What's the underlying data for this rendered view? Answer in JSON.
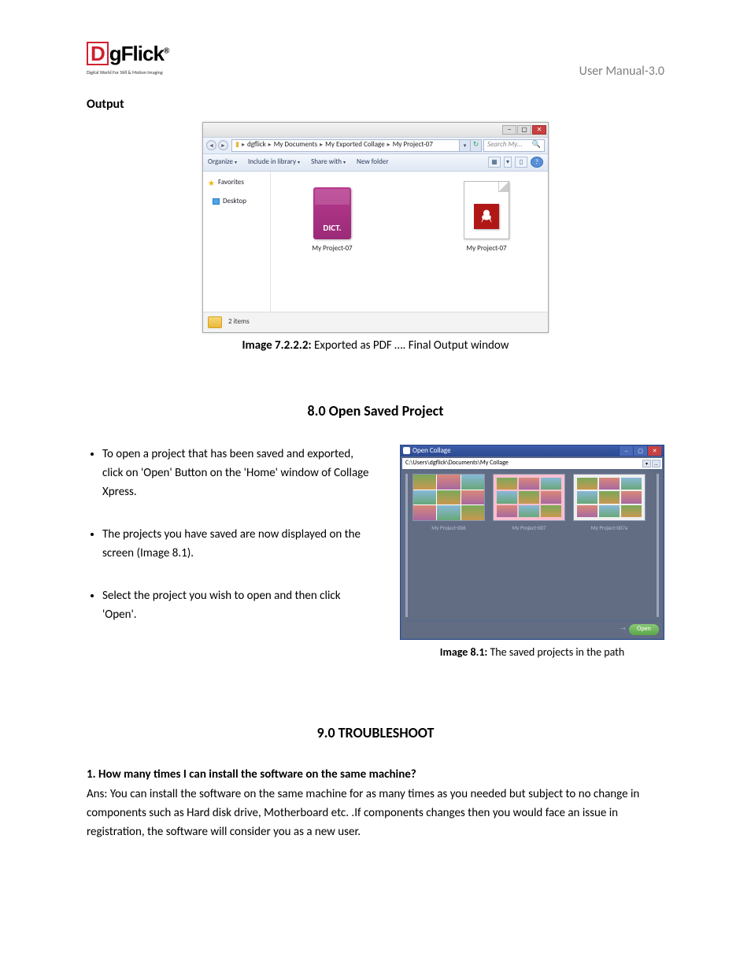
{
  "header": {
    "logo_text": "gFlick",
    "logo_letter": "D",
    "logo_sub": "Digital World For Still & Motion Imaging",
    "right": "User Manual-3.0"
  },
  "output_section": {
    "title": "Output"
  },
  "explorer": {
    "breadcrumb": [
      "dgflick",
      "My Documents",
      "My Exported Collage",
      "My Project-07"
    ],
    "search_placeholder": "Search My...",
    "toolbar": {
      "organize": "Organize",
      "include": "Include in library",
      "share": "Share with",
      "newfolder": "New folder"
    },
    "sidebar": {
      "favorites": "Favorites",
      "desktop": "Desktop"
    },
    "files": [
      {
        "label": "My Project-07",
        "dict_text": "DICT."
      },
      {
        "label": "My Project-07"
      }
    ],
    "status": "2 items"
  },
  "caption1": {
    "bold": "Image 7.2.2.2:",
    "rest": " Exported as PDF …. Final Output window"
  },
  "heading2": "8.0 Open Saved Project",
  "bullets": [
    "To open a project that has been saved and exported, click on 'Open' Button on the 'Home' window of Collage Xpress.",
    "The projects you have saved are now displayed on the screen (Image 8.1).",
    "Select the project you wish to open and then click 'Open'."
  ],
  "open_collage": {
    "title": "Open Collage",
    "path": "C:\\Users\\dgflick\\Documents\\My Collage",
    "thumbs": [
      "My Project-006",
      "My Project-007",
      "My Project-007a"
    ],
    "open": "Open"
  },
  "caption2": {
    "bold": "Image 8.1:",
    "rest": " The saved projects in the path"
  },
  "heading3": "9.0 TROUBLESHOOT",
  "faq": {
    "q": "1. How many times I can install the software on the same machine?",
    "a": "Ans: You can install the software on the same machine for as many times as you needed but subject to no change in components such as Hard disk drive, Motherboard etc. .If components changes then you would face an issue in registration, the software will consider you as a new user."
  }
}
